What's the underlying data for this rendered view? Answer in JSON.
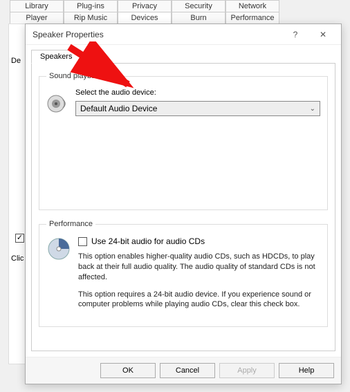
{
  "bg": {
    "tabs_row1": [
      "Library",
      "Plug-ins",
      "Privacy",
      "Security",
      "Network"
    ],
    "tabs_row2": [
      "Player",
      "Rip Music",
      "Devices",
      "Burn",
      "Performance"
    ],
    "active_tab": "Devices",
    "dev_label_fragment": "De",
    "click_fragment": "Clic"
  },
  "dialog": {
    "title": "Speaker Properties",
    "help_glyph": "?",
    "close_glyph": "✕",
    "tab": "Speakers",
    "playback": {
      "legend": "Sound playback",
      "select_label": "Select the audio device:",
      "combo_value": "Default Audio Device",
      "chevron": "⌄"
    },
    "performance": {
      "legend": "Performance",
      "checkbox_label": "Use 24-bit audio for audio CDs",
      "desc1": "This option enables higher-quality audio CDs, such as HDCDs, to play back at their full audio quality. The audio quality of standard CDs is not affected.",
      "desc2": "This option requires a 24-bit audio device. If you experience sound or computer problems while playing audio CDs, clear this check box."
    },
    "buttons": {
      "ok": "OK",
      "cancel": "Cancel",
      "apply": "Apply",
      "help": "Help"
    }
  }
}
